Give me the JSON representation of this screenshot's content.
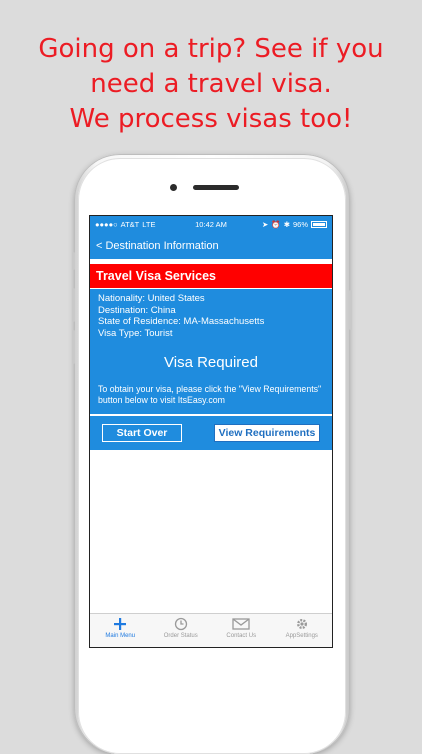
{
  "promo": {
    "line1": "Going on a trip? See if you",
    "line2": "need a travel visa.",
    "line3": "We process visas too!"
  },
  "statusbar": {
    "carrier": "AT&T",
    "network": "LTE",
    "time": "10:42 AM",
    "battery": "96%"
  },
  "navbar": {
    "back_label": "< Destination Information"
  },
  "card": {
    "header": "Travel Visa Services",
    "nationality": "Nationality: United States",
    "destination": "Destination: China",
    "residence": "State of Residence: MA-Massachusetts",
    "visa_type": "Visa Type: Tourist",
    "result": "Visa Required",
    "note": "To obtain your visa, please click the \"View Requirements\" button below to visit ItsEasy.com"
  },
  "buttons": {
    "start_over": "Start Over",
    "view_requirements": "View Requirements"
  },
  "tabs": [
    {
      "label": "Main Menu",
      "icon": "plus-icon",
      "active": true
    },
    {
      "label": "Order Status",
      "icon": "clock-icon",
      "active": false
    },
    {
      "label": "Contact Us",
      "icon": "mail-icon",
      "active": false
    },
    {
      "label": "AppSettings",
      "icon": "gear-icon",
      "active": false
    }
  ],
  "colors": {
    "promo_red": "#ec1c24",
    "app_blue": "#1f8cde",
    "header_red": "#ff0000",
    "tab_active": "#1f7ae0"
  }
}
